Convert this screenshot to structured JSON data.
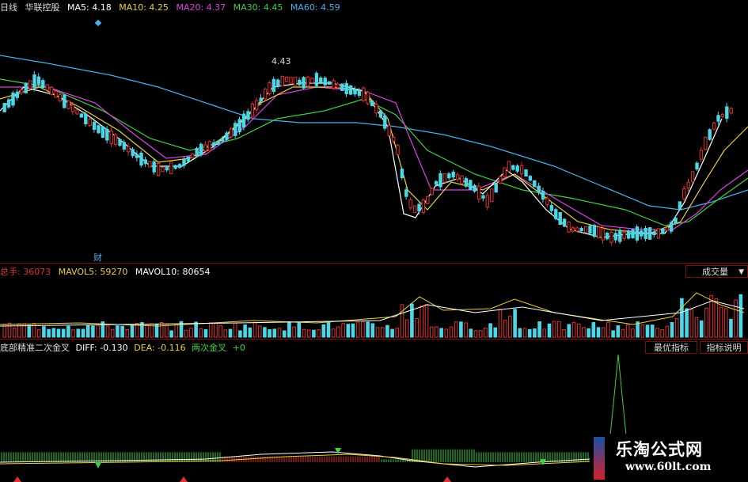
{
  "header": {
    "period": "日线",
    "stock_name": "华联控股",
    "ma": [
      {
        "label": "MA5: 4.18",
        "color": "#ffffff"
      },
      {
        "label": "MA10: 4.25",
        "color": "#e8d23c"
      },
      {
        "label": "MA20: 4.37",
        "color": "#e040e0"
      },
      {
        "label": "MA30: 4.45",
        "color": "#40d040"
      },
      {
        "label": "MA60: 4.59",
        "color": "#4ab0e8"
      }
    ]
  },
  "main_chart": {
    "high_marker": "4.43",
    "finance_marker": "财"
  },
  "volume_panel": {
    "total_label": "总手: 36073",
    "mavol5_label": "MAVOL5: 59270",
    "mavol10_label": "MAVOL10: 80654",
    "indicator_select": "成交量",
    "colors": {
      "total": "#e03030",
      "mavol5": "#e8d23c",
      "mavol10": "#ffffff"
    }
  },
  "indicator_panel": {
    "name": "底部精准二次金叉",
    "diff_label": "DIFF: -0.130",
    "dea_label": "DEA: -0.116",
    "cross_label": "两次金叉",
    "cross_value": "+0",
    "best_button": "最优指标",
    "help_button": "指标说明",
    "colors": {
      "diff": "#ffffff",
      "dea": "#e8d23c",
      "cross": "#40d040"
    }
  },
  "watermark": {
    "title": "乐淘公式网",
    "url": "www.60lt.com"
  }
}
